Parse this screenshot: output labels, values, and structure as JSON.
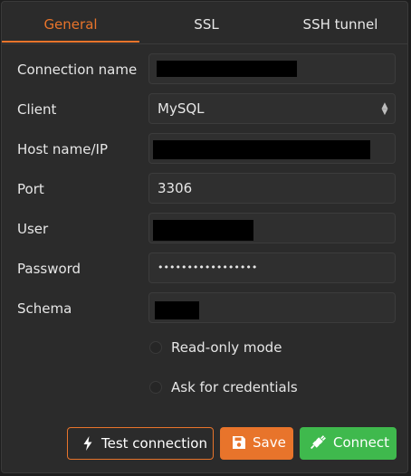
{
  "tabs": {
    "general": "General",
    "ssl": "SSL",
    "ssh": "SSH tunnel"
  },
  "form": {
    "connection_name_label": "Connection name",
    "client_label": "Client",
    "client_value": "MySQL",
    "host_label": "Host name/IP",
    "port_label": "Port",
    "port_value": "3306",
    "user_label": "User",
    "password_label": "Password",
    "password_value": "•••••••••••••••••",
    "schema_label": "Schema"
  },
  "options": {
    "readonly_label": "Read-only mode",
    "credentials_label": "Ask for credentials"
  },
  "buttons": {
    "test_label": "Test connection",
    "save_label": "Save",
    "connect_label": "Connect"
  },
  "icons": {
    "test": "lightning-bolt-icon",
    "save": "floppy-disk-icon",
    "connect": "plug-connect-icon"
  },
  "colors": {
    "accent_orange": "#e8742b",
    "connect_green": "#3fb94d",
    "panel_bg": "#2b2b2b",
    "field_bg": "#2f2f2f"
  }
}
